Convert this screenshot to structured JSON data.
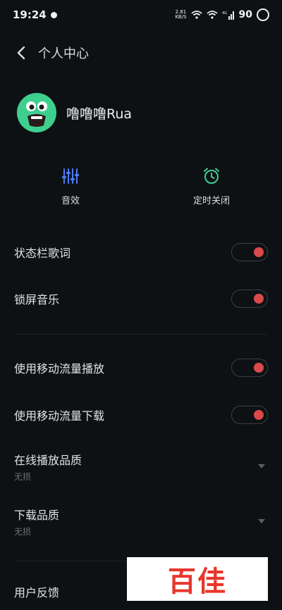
{
  "status_bar": {
    "time": "19:24",
    "net_speed": "2.81",
    "net_unit": "KB/S",
    "signal_label": "4G",
    "battery": "90"
  },
  "header": {
    "title": "个人中心"
  },
  "profile": {
    "username": "噜噜噜Rua"
  },
  "quick_actions": [
    {
      "label": "音效",
      "icon": "equalizer-icon",
      "color": "#4b7bf5"
    },
    {
      "label": "定时关闭",
      "icon": "alarm-clock-icon",
      "color": "#3ecf8e"
    }
  ],
  "settings": [
    {
      "label": "状态栏歌词",
      "enabled": true
    },
    {
      "label": "锁屏音乐",
      "enabled": true
    },
    {
      "label": "使用移动流量播放",
      "enabled": true
    },
    {
      "label": "使用移动流量下载",
      "enabled": true
    }
  ],
  "quality": [
    {
      "label": "在线播放品质",
      "value": "无损"
    },
    {
      "label": "下载品质",
      "value": "无损"
    }
  ],
  "feedback": {
    "label": "用户反馈"
  },
  "watermark": {
    "text": "百佳"
  },
  "colors": {
    "background": "#0e1114",
    "toggle_on": "#d94a4a",
    "accent_blue": "#4b7bf5",
    "accent_green": "#3ecf8e"
  }
}
